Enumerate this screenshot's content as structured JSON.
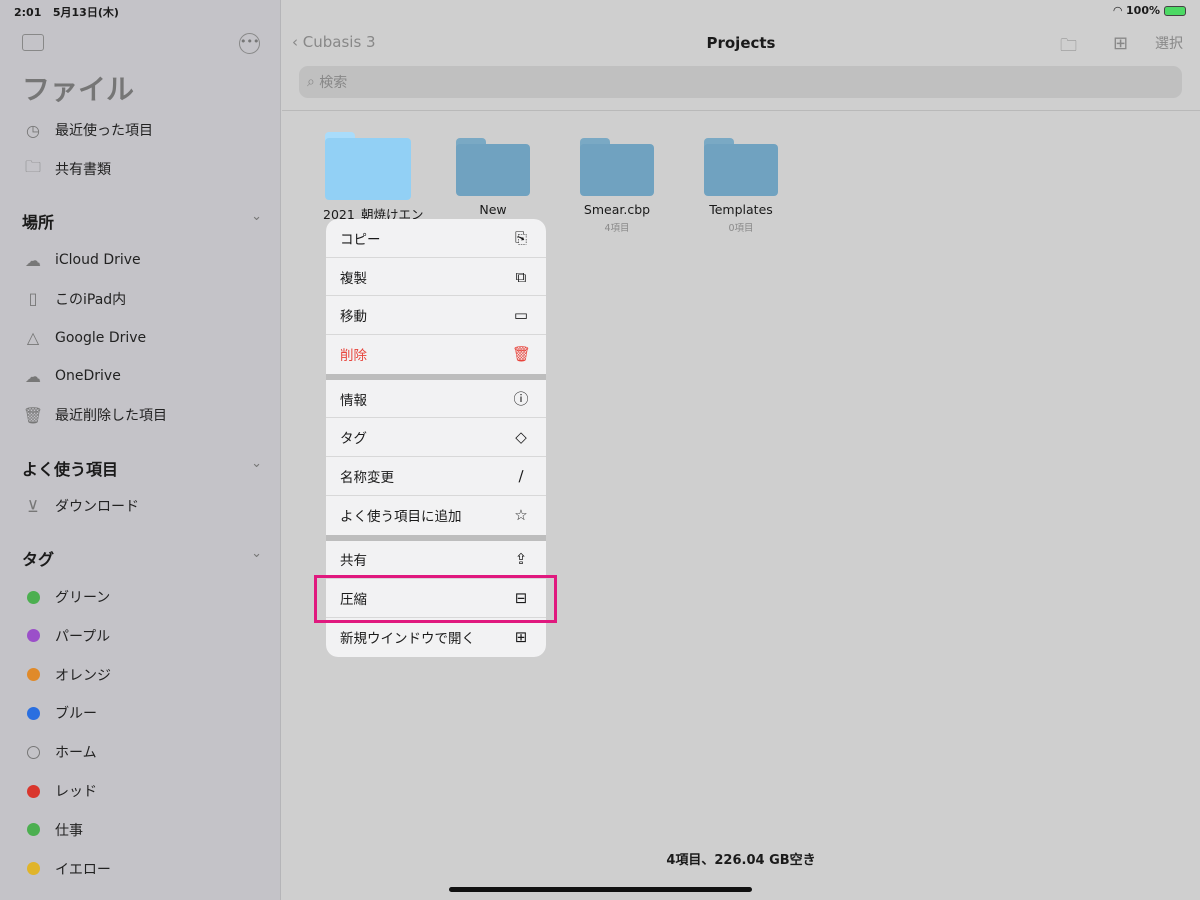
{
  "status": {
    "time": "2:01",
    "date": "5月13日(木)",
    "battery": "100%"
  },
  "sidebar": {
    "title": "ファイル",
    "top_items": [
      {
        "label": "最近使った項目",
        "icon": "clock-icon"
      },
      {
        "label": "共有書類",
        "icon": "shared-folder-icon"
      }
    ],
    "locations_header": "場所",
    "locations": [
      {
        "label": "iCloud Drive",
        "icon": "icloud-icon"
      },
      {
        "label": "このiPad内",
        "icon": "ipad-icon"
      },
      {
        "label": "Google Drive",
        "icon": "google-drive-icon"
      },
      {
        "label": "OneDrive",
        "icon": "onedrive-icon"
      },
      {
        "label": "最近削除した項目",
        "icon": "trash-icon"
      }
    ],
    "favorites_header": "よく使う項目",
    "favorites": [
      {
        "label": "ダウンロード",
        "icon": "download-icon"
      }
    ],
    "tags_header": "タグ",
    "tags": [
      {
        "label": "グリーン",
        "color": "#4caf50"
      },
      {
        "label": "パープル",
        "color": "#9b4fc9"
      },
      {
        "label": "オレンジ",
        "color": "#e08a2a"
      },
      {
        "label": "ブルー",
        "color": "#2a6fe0"
      },
      {
        "label": "ホーム",
        "color": ""
      },
      {
        "label": "レッド",
        "color": "#d9362d"
      },
      {
        "label": "仕事",
        "color": "#4caf50"
      },
      {
        "label": "イエロー",
        "color": "#e0b42a"
      }
    ]
  },
  "nav": {
    "back": "Cubasis 3",
    "title": "Projects",
    "select": "選択",
    "search_placeholder": "検索"
  },
  "folders": [
    {
      "name": "2021_朝焼けエン",
      "count": ""
    },
    {
      "name": "New",
      "count": ""
    },
    {
      "name": "Smear.cbp",
      "count": "4項目"
    },
    {
      "name": "Templates",
      "count": "0項目"
    }
  ],
  "menu": [
    [
      {
        "label": "コピー",
        "icon": "copy-icon",
        "glyph": "⎘"
      },
      {
        "label": "複製",
        "icon": "duplicate-icon",
        "glyph": "⧉"
      },
      {
        "label": "移動",
        "icon": "folder-icon",
        "glyph": "▭"
      },
      {
        "label": "削除",
        "icon": "trash-icon",
        "glyph": "🗑"
      }
    ],
    [
      {
        "label": "情報",
        "icon": "info-icon",
        "glyph": "ⓘ"
      },
      {
        "label": "タグ",
        "icon": "tag-icon",
        "glyph": "◇"
      },
      {
        "label": "名称変更",
        "icon": "pencil-icon",
        "glyph": "∕"
      },
      {
        "label": "よく使う項目に追加",
        "icon": "star-icon",
        "glyph": "☆"
      }
    ],
    [
      {
        "label": "共有",
        "icon": "share-icon",
        "glyph": "⇪"
      },
      {
        "label": "圧縮",
        "icon": "archive-icon",
        "glyph": "⊟"
      },
      {
        "label": "新規ウインドウで開く",
        "icon": "grid-icon",
        "glyph": "⊞"
      }
    ]
  ],
  "footer": "4項目、226.04 GB空き"
}
